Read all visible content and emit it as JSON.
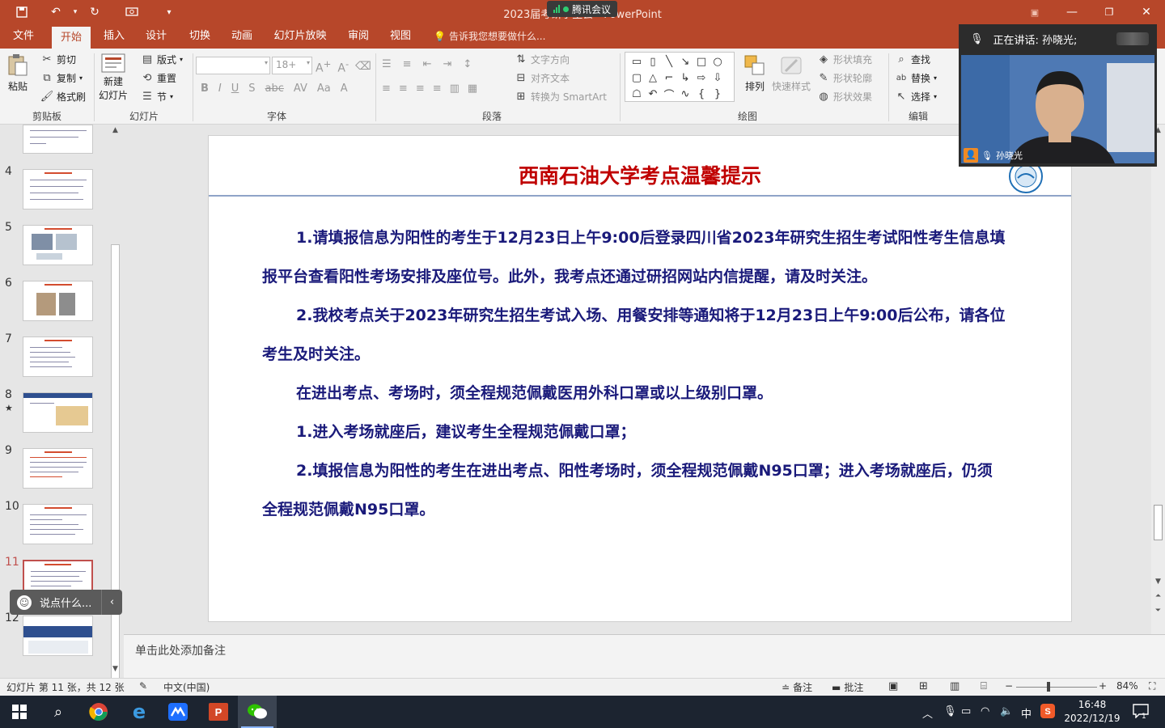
{
  "titlebar": {
    "title": "2023届考研学生会 - PowerPoint",
    "meeting_label": "腾讯会议"
  },
  "menu": {
    "tabs": [
      "文件",
      "开始",
      "插入",
      "设计",
      "切换",
      "动画",
      "幻灯片放映",
      "审阅",
      "视图"
    ],
    "active": "开始",
    "tell_me": "告诉我您想要做什么..."
  },
  "ribbon": {
    "clipboard": {
      "paste": "粘贴",
      "cut": "剪切",
      "copy": "复制",
      "format_painter": "格式刷",
      "label": "剪贴板"
    },
    "slides": {
      "new_slide": "新建",
      "new_slide2": "幻灯片",
      "layout": "版式",
      "reset": "重置",
      "section": "节",
      "label": "幻灯片"
    },
    "font": {
      "size": "18+",
      "label": "字体"
    },
    "paragraph": {
      "text_direction": "文字方向",
      "align_text": "对齐文本",
      "smartart": "转换为 SmartArt",
      "label": "段落"
    },
    "drawing": {
      "arrange": "排列",
      "quick_styles": "快速样式",
      "shape_fill": "形状填充",
      "shape_outline": "形状轮廓",
      "shape_effects": "形状效果",
      "label": "绘图"
    },
    "editing": {
      "find": "查找",
      "replace": "替换",
      "select": "选择",
      "label": "编辑"
    }
  },
  "thumbnails": {
    "numbers": [
      "4",
      "5",
      "6",
      "7",
      "8",
      "9",
      "10",
      "11",
      "12"
    ],
    "star": "★",
    "selected_index": 7
  },
  "say_box": {
    "placeholder": "说点什么..."
  },
  "slide": {
    "title": "西南石油大学考点温馨提示",
    "paragraphs": [
      "1.请填报信息为阳性的考生于12月23日上午9:00后登录四川省2023年研究生招生考试阳性考生信息填报平台查看阳性考场安排及座位号。此外，我考点还通过研招网站内信提醒，请及时关注。",
      "2.我校考点关于2023年研究生招生考试入场、用餐安排等通知将于12月23日上午9:00后公布，请各位考生及时关注。",
      "在进出考点、考场时，须全程规范佩戴医用外科口罩或以上级别口罩。",
      "1.进入考场就座后，建议考生全程规范佩戴口罩；",
      "2.填报信息为阳性的考生在进出考点、阳性考场时，须全程规范佩戴N95口罩；进入考场就座后，仍须全程规范佩戴N95口罩。"
    ]
  },
  "notes": {
    "placeholder": "单击此处添加备注"
  },
  "statusbar": {
    "slide_info": "幻灯片 第 11 张，共 12 张",
    "language": "中文(中国)",
    "notes": "备注",
    "comments": "批注",
    "zoom": "84%"
  },
  "video": {
    "speaking_label": "正在讲话: 孙晓光;",
    "participant_name": "孙晓光"
  },
  "taskbar": {
    "time": "16:48",
    "date": "2022/12/19",
    "ime": "中",
    "notifications": "1"
  },
  "colors": {
    "accent": "#b7472a",
    "slide_title": "#c00000",
    "slide_text": "#1a1a7a"
  }
}
